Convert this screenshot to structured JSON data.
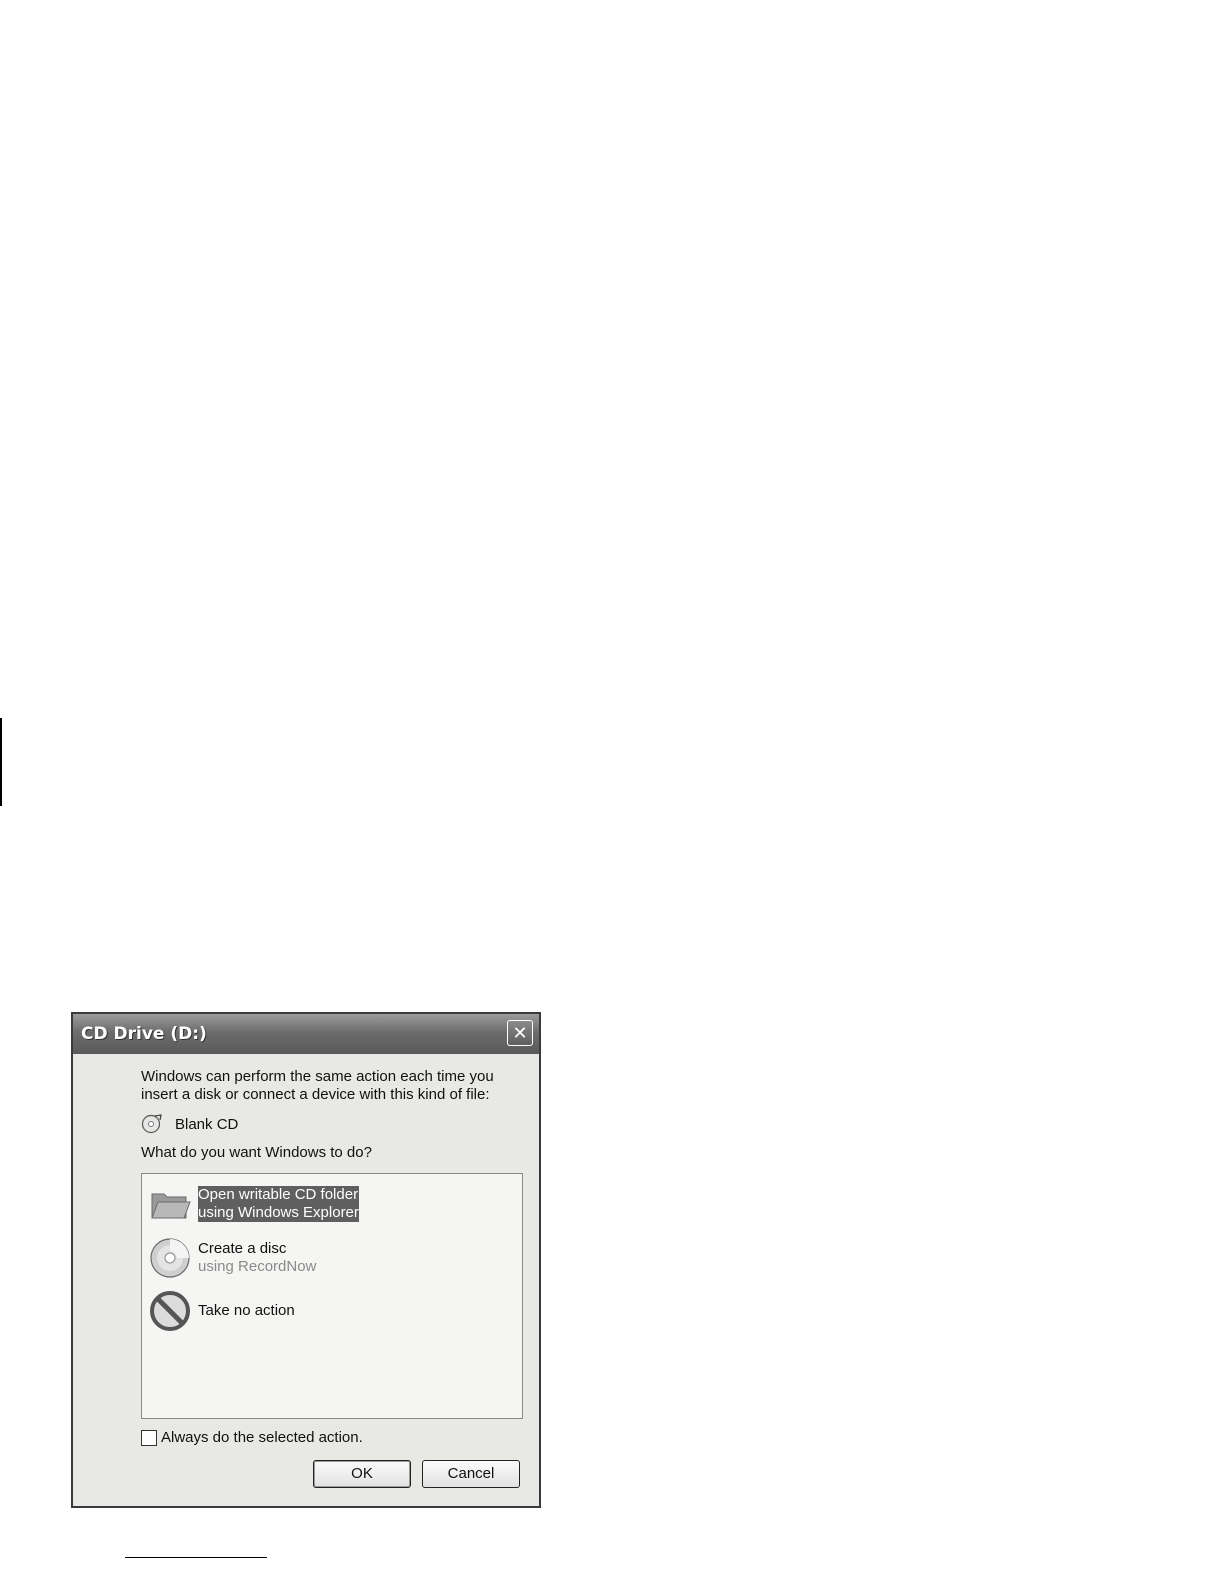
{
  "dialog": {
    "title": "CD Drive (D:)",
    "close_label": "✕",
    "intro": "Windows can perform the same action each time you insert a disk or connect a device with this kind of file:",
    "content_type": "Blank CD",
    "question": "What do you want Windows to do?",
    "options": [
      {
        "line1": "Open writable CD folder",
        "line2": "using Windows Explorer",
        "icon": "folder-icon",
        "selected": true
      },
      {
        "line1": "Create a disc",
        "line2": "using RecordNow",
        "icon": "cd-icon",
        "selected": false
      },
      {
        "line1": "Take no action",
        "line2": "",
        "icon": "no-action-icon",
        "selected": false
      }
    ],
    "always_label": "Always do the selected action.",
    "always_checked": false,
    "ok_label": "OK",
    "cancel_label": "Cancel"
  }
}
